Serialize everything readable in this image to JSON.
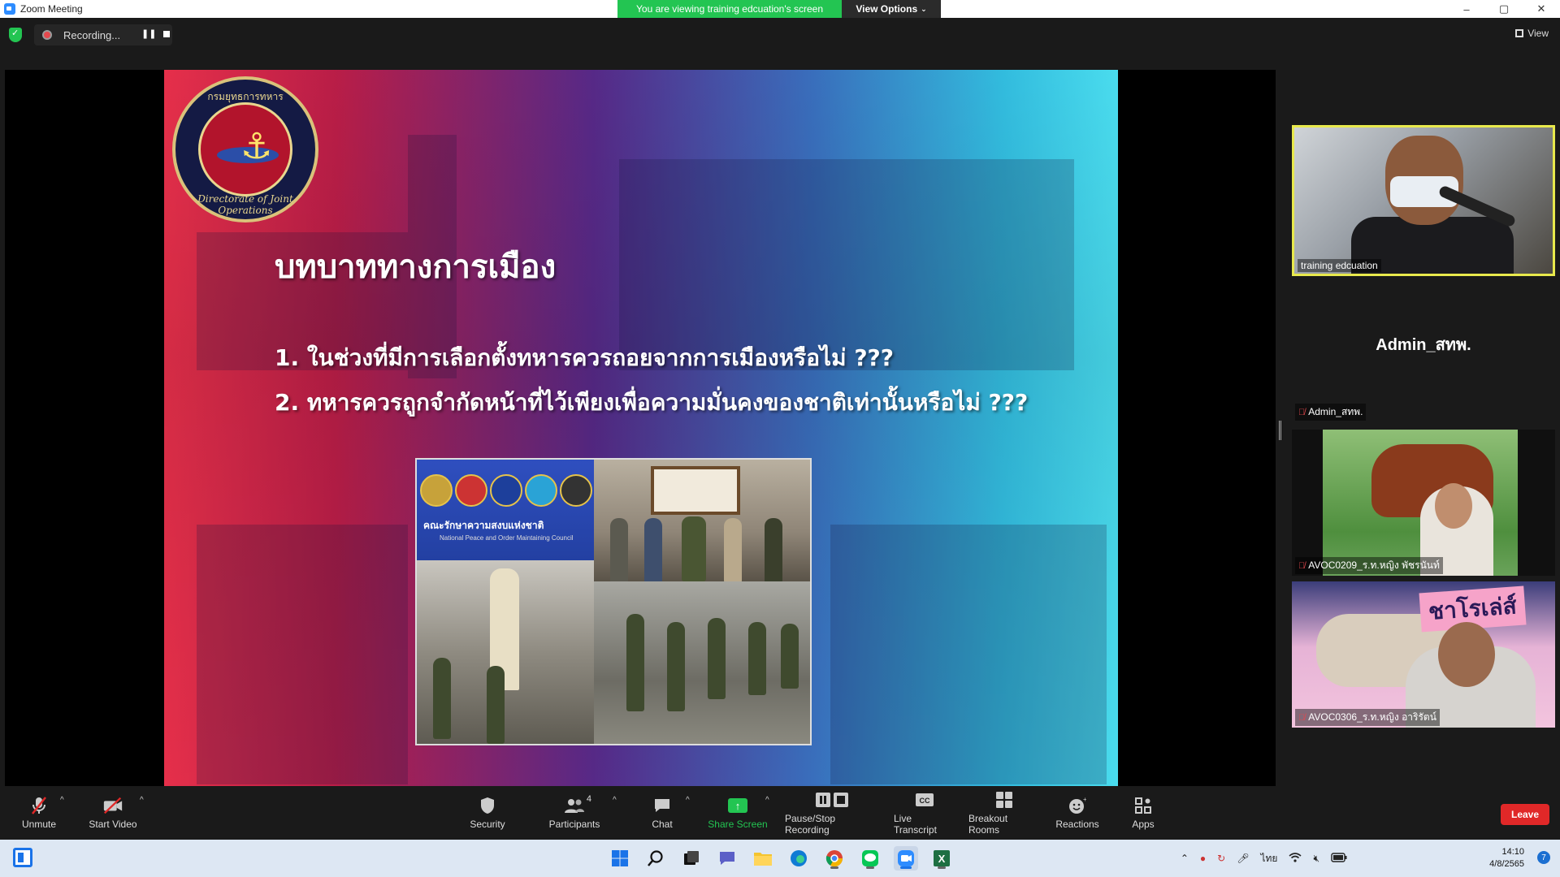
{
  "window": {
    "title": "Zoom Meeting",
    "controls": [
      "–",
      "▢",
      "✕"
    ]
  },
  "banner": {
    "message": "You are viewing training edcuation's screen",
    "view_options": "View Options"
  },
  "topbar": {
    "recording_label": "Recording...",
    "view_label": "View"
  },
  "slide": {
    "seal_top_text": "กรมยุทธการทหาร",
    "seal_bottom_text": "Directorate of Joint Operations",
    "title": "บทบาททางการเมือง",
    "items": [
      "1. ในช่วงที่มีการเลือกตั้งทหารควรถอยจากการเมืองหรือไม่ ???",
      "2. ทหารควรถูกจำกัดหน้าที่ไว้เพียงเพื่อความมั่นคงของชาติเท่านั้นหรือไม่ ???"
    ],
    "collage_caption": "คณะรักษาความสงบแห่งชาติ",
    "collage_subcaption": "National Peace and Order Maintaining Council"
  },
  "participants": [
    {
      "name": "training edcuation",
      "muted": false,
      "active_speaker": true
    },
    {
      "name": "Admin_สทพ.",
      "muted": true,
      "video": false
    },
    {
      "name": "AVOC0209_ร.ท.หญิง พัชรนันท์",
      "muted": true
    },
    {
      "name": "AVOC0306_ร.ท.หญิง อาริรัตน์",
      "muted": true,
      "sticker": "ชาโรเล่ส์"
    }
  ],
  "toolbar": {
    "unmute": "Unmute",
    "start_video": "Start Video",
    "security": "Security",
    "participants": "Participants",
    "participants_count": "4",
    "chat": "Chat",
    "share_screen": "Share Screen",
    "pause_stop_recording": "Pause/Stop Recording",
    "live_transcript": "Live Transcript",
    "breakout_rooms": "Breakout Rooms",
    "reactions": "Reactions",
    "apps": "Apps",
    "leave": "Leave"
  },
  "taskbar": {
    "language": "ไทย",
    "time": "14:10",
    "date": "4/8/2565",
    "notifications": "7"
  },
  "colors": {
    "zoom_green": "#23c552",
    "leave_red": "#e02828",
    "active_speaker_border": "#e8e94c"
  }
}
